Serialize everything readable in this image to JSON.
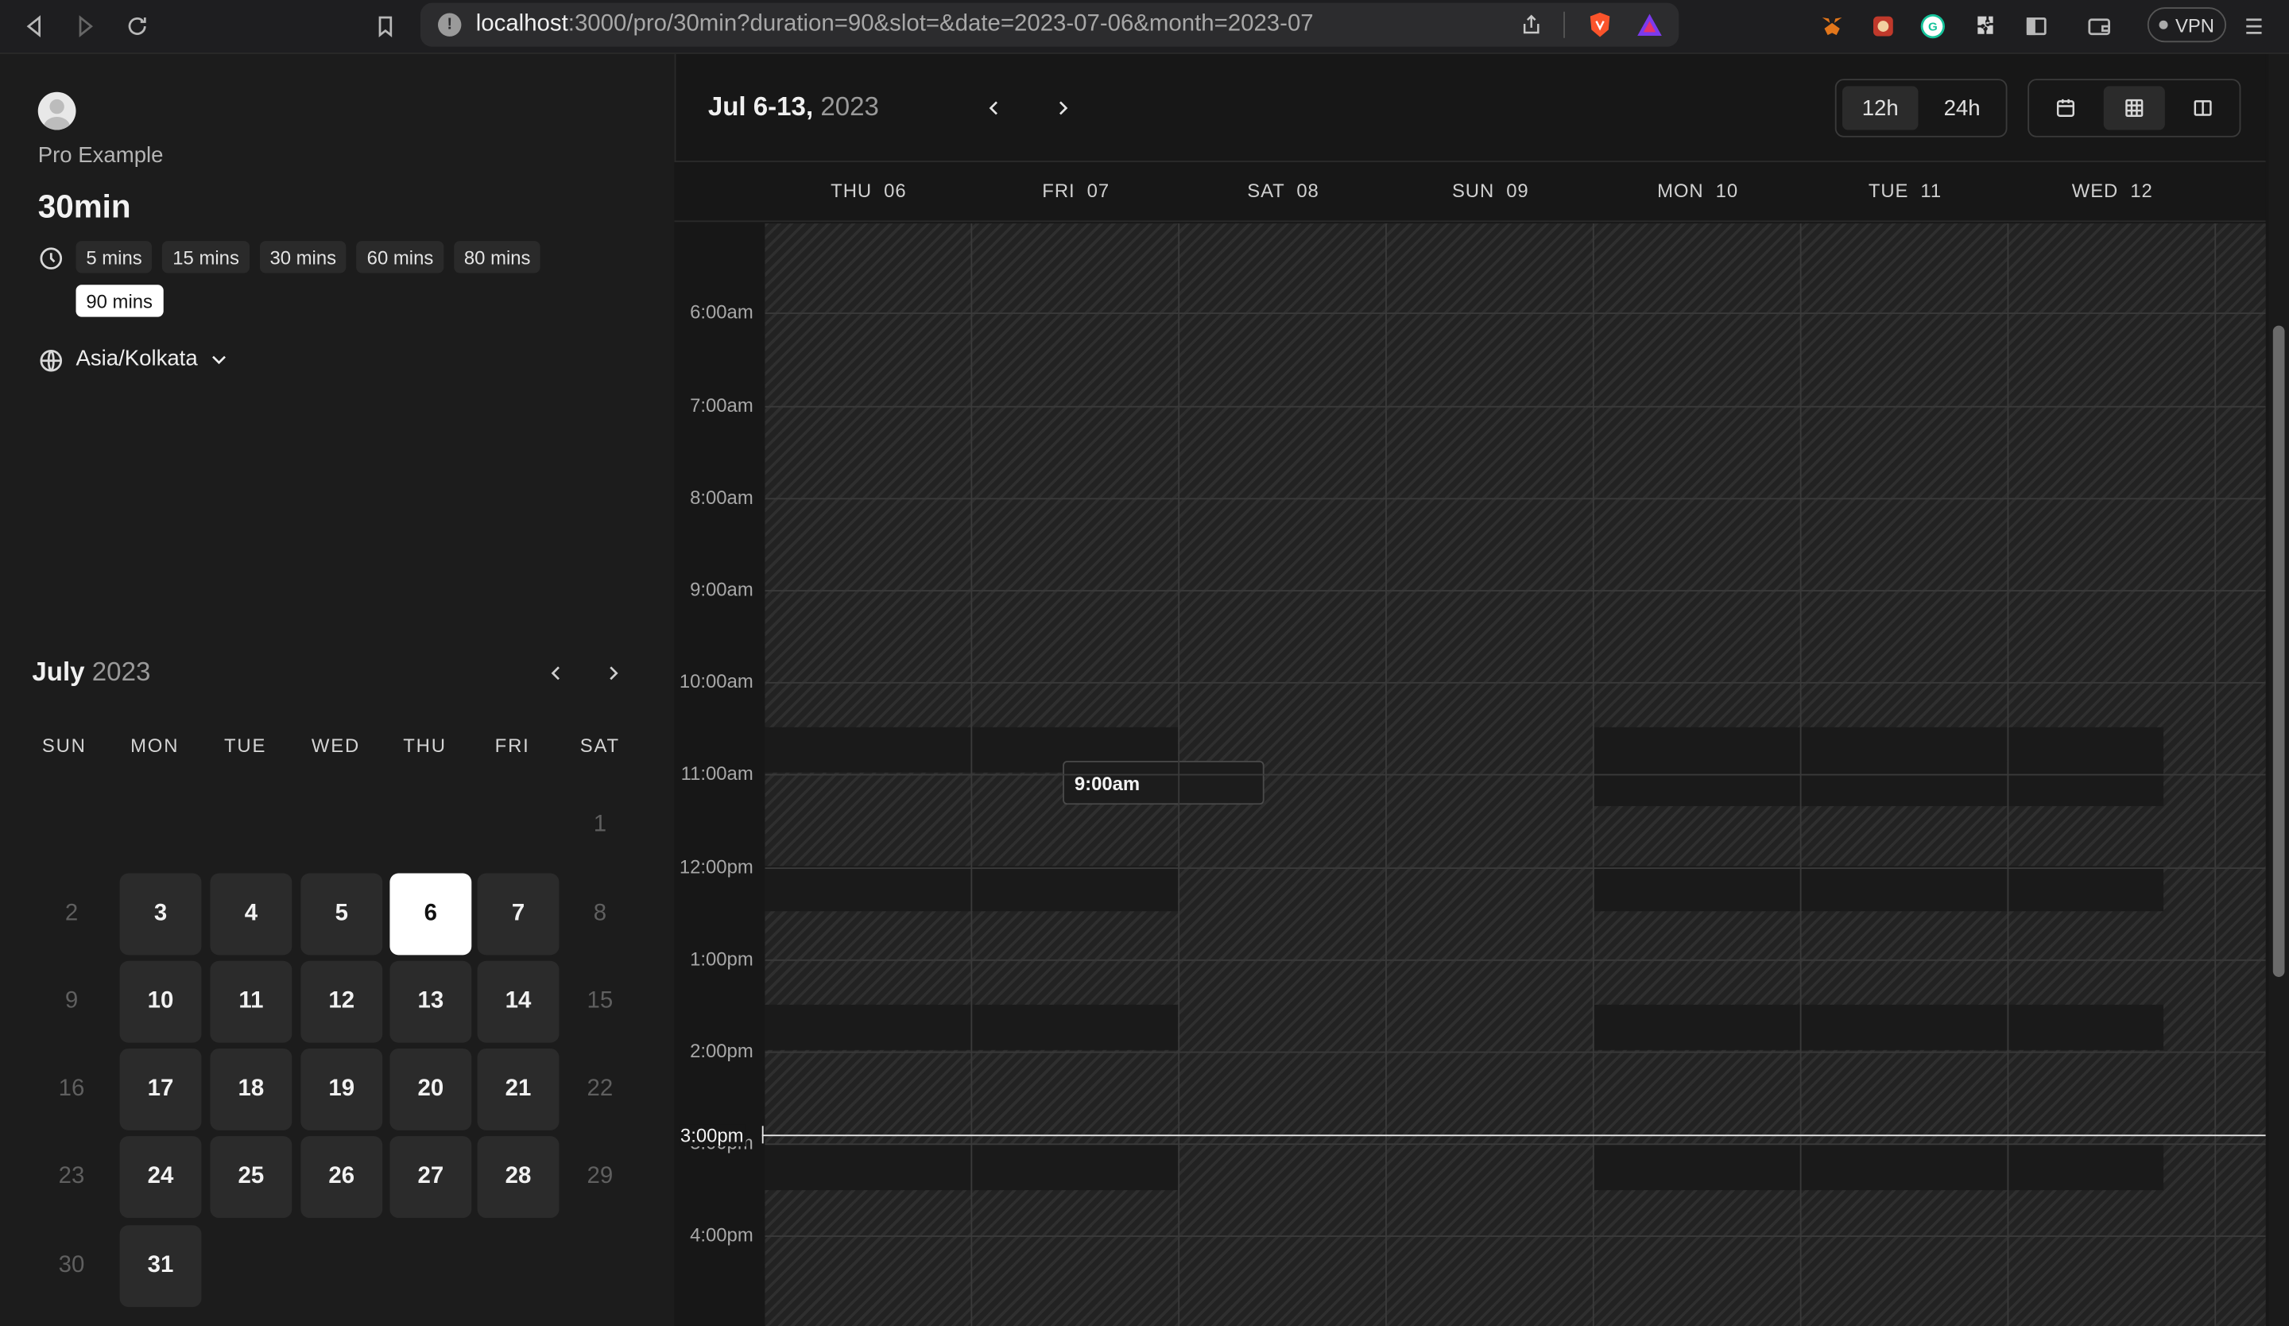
{
  "browser": {
    "url_host": "localhost",
    "url_rest": ":3000/pro/30min?duration=90&slot=&date=2023-07-06&month=2023-07",
    "vpn_label": "VPN"
  },
  "profile": {
    "owner": "Pro Example",
    "event_title": "30min"
  },
  "durations": [
    {
      "label": "5 mins",
      "active": false
    },
    {
      "label": "15 mins",
      "active": false
    },
    {
      "label": "30 mins",
      "active": false
    },
    {
      "label": "60 mins",
      "active": false
    },
    {
      "label": "80 mins",
      "active": false
    },
    {
      "label": "90 mins",
      "active": true
    }
  ],
  "timezone": "Asia/Kolkata",
  "month_picker": {
    "month": "July",
    "year": "2023",
    "weekdays": [
      "SUN",
      "MON",
      "TUE",
      "WED",
      "THU",
      "FRI",
      "SAT"
    ],
    "weeks": [
      [
        null,
        null,
        null,
        null,
        null,
        null,
        {
          "d": "1",
          "s": "off"
        }
      ],
      [
        {
          "d": "2",
          "s": "off"
        },
        {
          "d": "3",
          "s": "avail"
        },
        {
          "d": "4",
          "s": "avail"
        },
        {
          "d": "5",
          "s": "avail"
        },
        {
          "d": "6",
          "s": "sel"
        },
        {
          "d": "7",
          "s": "avail"
        },
        {
          "d": "8",
          "s": "off"
        }
      ],
      [
        {
          "d": "9",
          "s": "off"
        },
        {
          "d": "10",
          "s": "avail"
        },
        {
          "d": "11",
          "s": "avail"
        },
        {
          "d": "12",
          "s": "avail"
        },
        {
          "d": "13",
          "s": "avail"
        },
        {
          "d": "14",
          "s": "avail"
        },
        {
          "d": "15",
          "s": "off"
        }
      ],
      [
        {
          "d": "16",
          "s": "off"
        },
        {
          "d": "17",
          "s": "avail"
        },
        {
          "d": "18",
          "s": "avail"
        },
        {
          "d": "19",
          "s": "avail"
        },
        {
          "d": "20",
          "s": "avail"
        },
        {
          "d": "21",
          "s": "avail"
        },
        {
          "d": "22",
          "s": "off"
        }
      ],
      [
        {
          "d": "23",
          "s": "off"
        },
        {
          "d": "24",
          "s": "avail"
        },
        {
          "d": "25",
          "s": "avail"
        },
        {
          "d": "26",
          "s": "avail"
        },
        {
          "d": "27",
          "s": "avail"
        },
        {
          "d": "28",
          "s": "avail"
        },
        {
          "d": "29",
          "s": "off"
        }
      ],
      [
        {
          "d": "30",
          "s": "off"
        },
        {
          "d": "31",
          "s": "avail"
        },
        null,
        null,
        null,
        null,
        null
      ]
    ]
  },
  "week_view": {
    "range_label": "Jul 6-13,",
    "range_year": "2023",
    "toggle_12h": "12h",
    "toggle_24h": "24h",
    "days": [
      "THU  06",
      "FRI  07",
      "SAT  08",
      "SUN  09",
      "MON  10",
      "TUE  11",
      "WED  12"
    ],
    "time_labels": [
      {
        "label": "6:00am",
        "hours_after_5am": 1
      },
      {
        "label": "7:00am",
        "hours_after_5am": 2
      },
      {
        "label": "8:00am",
        "hours_after_5am": 3
      },
      {
        "label": "9:00am",
        "hours_after_5am": 4
      },
      {
        "label": "10:00am",
        "hours_after_5am": 5
      },
      {
        "label": "11:00am",
        "hours_after_5am": 6
      },
      {
        "label": "12:00pm",
        "hours_after_5am": 7
      },
      {
        "label": "1:00pm",
        "hours_after_5am": 8
      },
      {
        "label": "2:00pm",
        "hours_after_5am": 9
      },
      {
        "label": "3:00pm",
        "hours_after_5am": 10
      },
      {
        "label": "4:00pm",
        "hours_after_5am": 11
      }
    ],
    "available_slot": "9:00am",
    "now_label": "3:00pm"
  }
}
